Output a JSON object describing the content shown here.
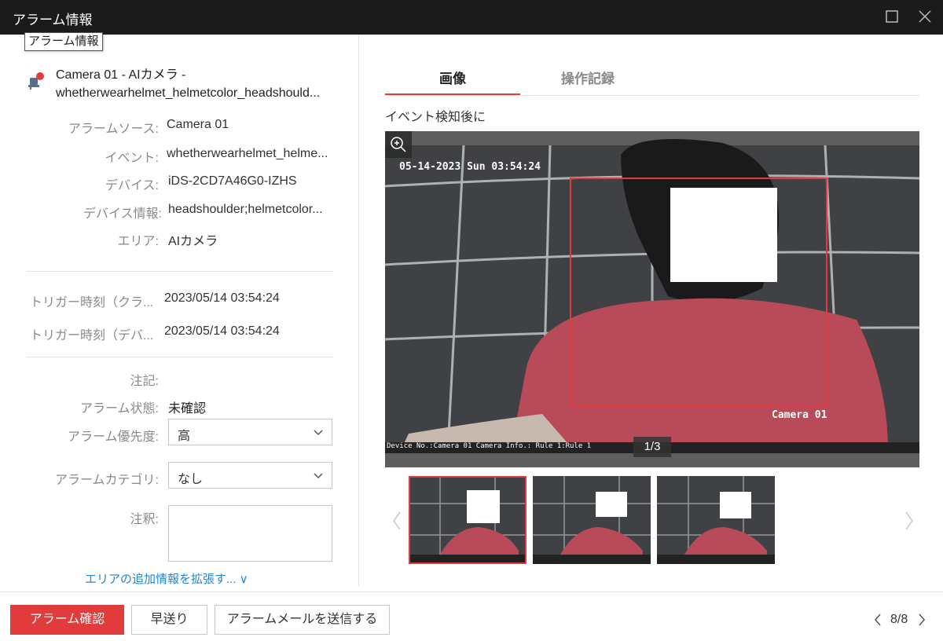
{
  "window": {
    "title": "アラーム情報",
    "tooltip": "アラーム情報"
  },
  "camera_header": {
    "line1": "Camera 01 - AIカメラ -",
    "line2": "whetherwearhelmet_helmetcolor_headshould..."
  },
  "details": [
    {
      "label": "アラームソース:",
      "value": "Camera 01"
    },
    {
      "label": "イベント:",
      "value": "whetherwearhelmet_helme..."
    },
    {
      "label": "デバイス:",
      "value": "iDS-2CD7A46G0-IZHS"
    },
    {
      "label": "デバイス情報:",
      "value": "headshoulder;helmetcolor..."
    },
    {
      "label": "エリア:",
      "value": "AIカメラ"
    }
  ],
  "triggers": [
    {
      "label": "トリガー時刻（クラ...",
      "value": "2023/05/14 03:54:24"
    },
    {
      "label": "トリガー時刻（デバ...",
      "value": "2023/05/14 03:54:24"
    }
  ],
  "form": {
    "note_label": "注記:",
    "status_label": "アラーム状態:",
    "status_value": "未確認",
    "priority_label": "アラーム優先度:",
    "priority_value": "高",
    "category_label": "アラームカテゴリ:",
    "category_value": "なし",
    "remark_label": "注釈:",
    "expand_link": "エリアの追加情報を拡張す... ∨"
  },
  "tabs": [
    {
      "label": "画像",
      "active": true
    },
    {
      "label": "操作記録",
      "active": false
    }
  ],
  "image_section": {
    "label": "イベント検知後に",
    "osd_time": "05-14-2023 Sun 03:54:24",
    "osd_camera": "Camera 01",
    "osd_info": "Device No.:Camera 01     Camera Info.:        Rule 1:Rule 1",
    "counter": "1/3",
    "thumbnail_count": 3,
    "active_thumbnail": 1
  },
  "buttons": {
    "confirm": "アラーム確認",
    "fast_forward": "早送り",
    "send_mail": "アラームメールを送信する"
  },
  "pager": {
    "value": "8/8"
  },
  "colors": {
    "accent": "#e23b3b",
    "titlebar": "#1b1b1b",
    "link": "#1f86d6"
  }
}
